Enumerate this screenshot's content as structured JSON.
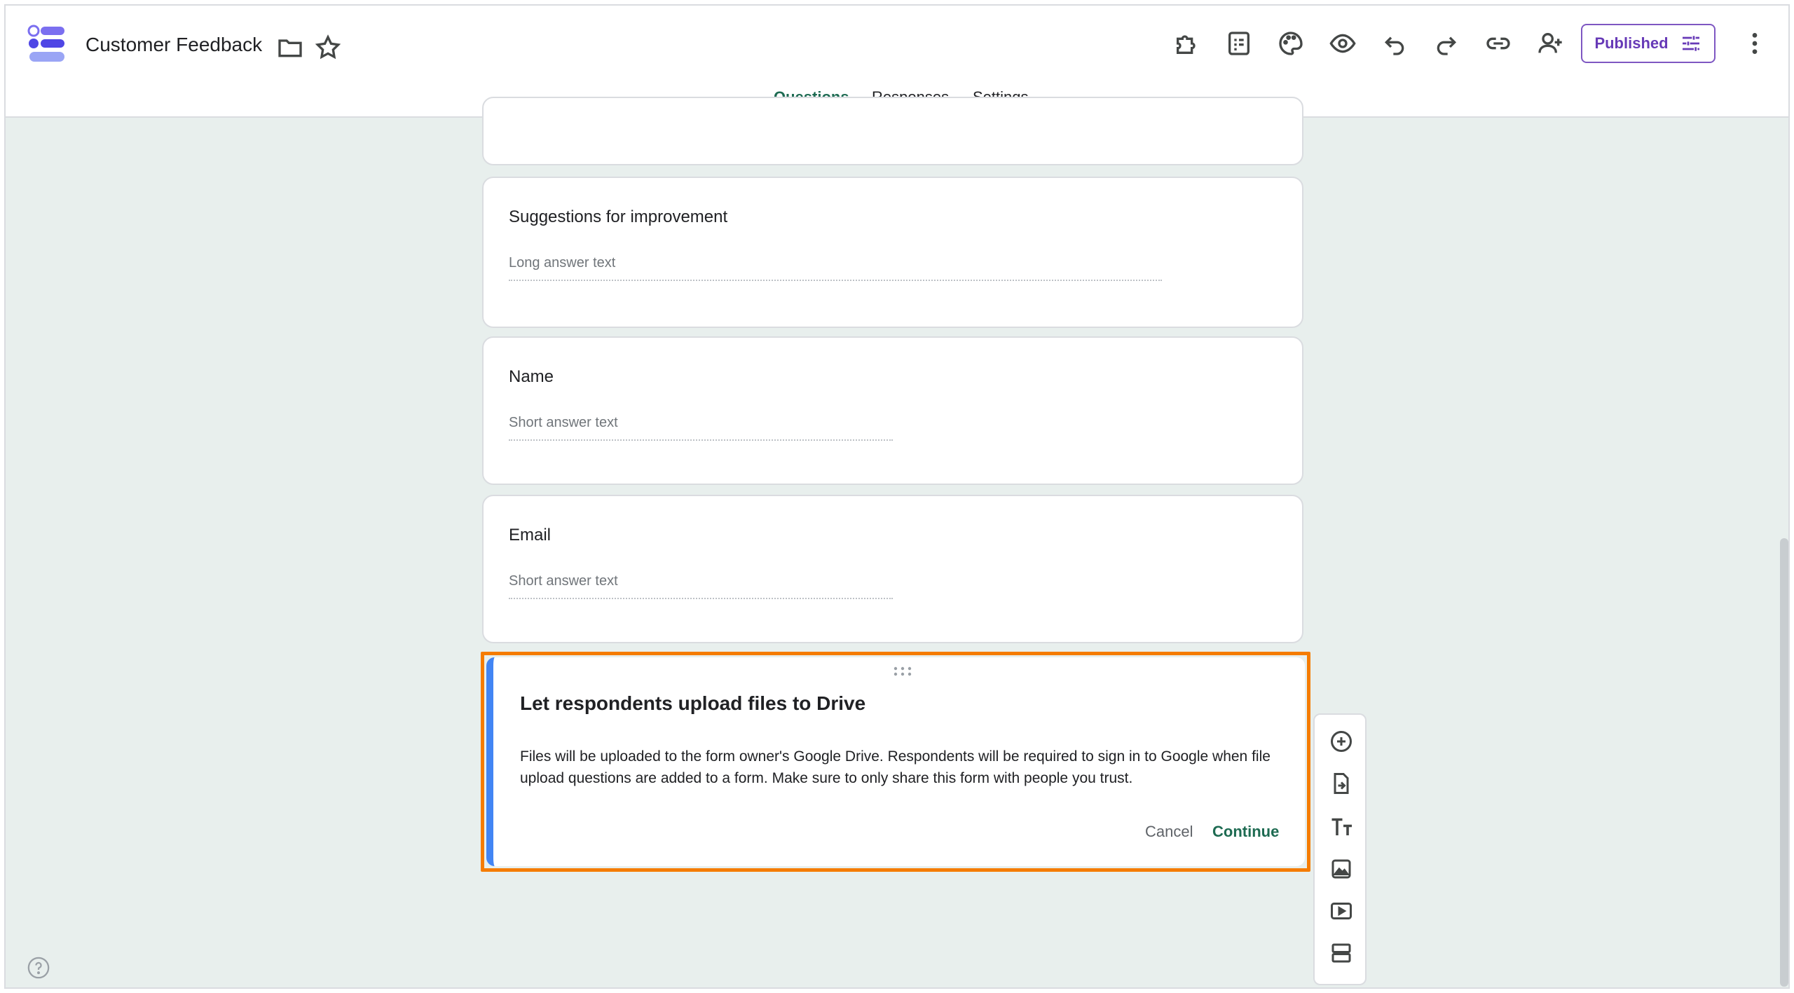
{
  "header": {
    "title": "Customer Feedback",
    "published_label": "Published"
  },
  "tabs": [
    {
      "label": "Questions",
      "active": true
    },
    {
      "label": "Responses",
      "active": false
    },
    {
      "label": "Settings",
      "active": false
    }
  ],
  "questions": [
    {
      "title": "Suggestions for improvement",
      "answer_placeholder": "Long answer text"
    },
    {
      "title": "Name",
      "answer_placeholder": "Short answer text"
    },
    {
      "title": "Email",
      "answer_placeholder": "Short answer text"
    }
  ],
  "dialog": {
    "title": "Let respondents upload files to Drive",
    "body": "Files will be uploaded to the form owner's Google Drive. Respondents will be required to sign in to Google when file upload questions are added to a form. Make sure to only share this form with people you trust.",
    "cancel_label": "Cancel",
    "continue_label": "Continue"
  },
  "colors": {
    "accent": "#1e6b52",
    "published": "#673ab7",
    "highlight": "#f57c00",
    "card_stripe": "#4285f4",
    "background": "#e8efed"
  }
}
